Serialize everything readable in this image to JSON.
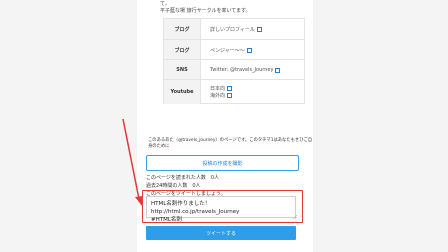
{
  "intro_lines": [
    "て。",
    "平子藍な場 旅行サークルを率いてます。"
  ],
  "profile_rows": [
    {
      "key": "ブログ",
      "value": "詳しいプロフィール"
    },
    {
      "key": "ブログ",
      "value": "ペンジャー〜〜"
    },
    {
      "key": "SNS",
      "value": "Twitter: @travels_Journey"
    },
    {
      "key": "Youtube",
      "value_lines": [
        "日本向",
        "海外向"
      ]
    }
  ],
  "caption_lines": [
    "このあるあた（@travels_journey）のページです。このタチマ1はあなたもせひご自",
    "身のために"
  ],
  "outline_button": "投稿の作成を撮影",
  "stats": {
    "total_views": "このページを読まれた人数　0人",
    "views_24h": "過去24時間の人数　0人",
    "tweet_prompt": "このページをツイートしましょう。"
  },
  "tweet_text_line1": "HTML名刺作りました！ http://html.co.jp/travels_Journey",
  "tweet_text_line2": "#HTML名刺",
  "tweet_button": "ツイートする",
  "colors": {
    "accent": "#2f9de8",
    "highlight": "#e23a3a"
  }
}
